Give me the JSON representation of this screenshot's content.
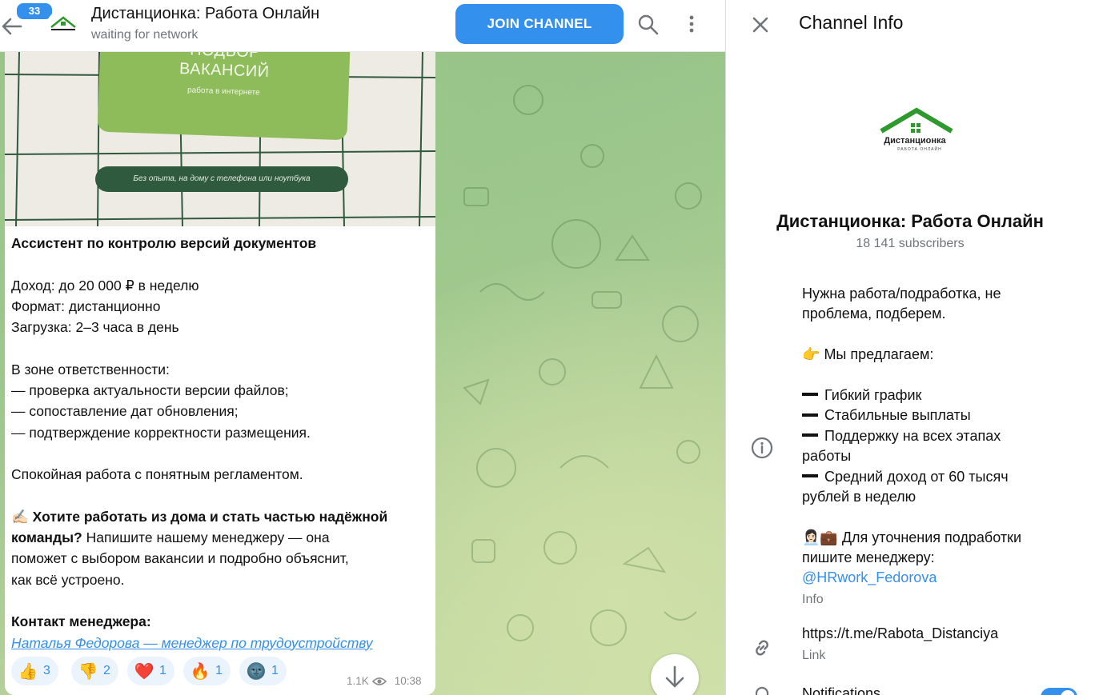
{
  "header": {
    "unread_count": "33",
    "title": "Дистанционка: Работа Онлайн",
    "status": "waiting for network",
    "join_label": "JOIN CHANNEL"
  },
  "message": {
    "image": {
      "title_top": "ПОДБОР",
      "title": "ВАКАНСИЙ",
      "subtitle": "работа в интернете",
      "pill": "Без опыта, на дому с телефона или ноутбука"
    },
    "lines": {
      "l1": "Ассистент по контролю версий документов",
      "l2": "Доход: до 20 000 ₽ в неделю",
      "l3": "Формат: дистанционно",
      "l4": "Загрузка: 2–3 часа в день",
      "l5": "В зоне ответственности:",
      "l6": "— проверка актуальности версии файлов;",
      "l7": "— сопоставление дат обновления;",
      "l8": "— подтверждение корректности размещения.",
      "l9": "Спокойная работа с понятным регламентом.",
      "l10_emoji": "✍🏻",
      "l10_bold": "Хотите работать из дома и стать частью надёжной",
      "l11_bold": "команды?",
      "l11_rest": "Напишите нашему менеджеру — она",
      "l12": "поможет с выбором вакансии и подробно объяснит,",
      "l13": "как всё устроено.",
      "l14": "Контакт менеджера:",
      "link": "Наталья Федорова — менеджер по трудоустройству"
    },
    "reactions": [
      {
        "emoji": "👍",
        "count": "3"
      },
      {
        "emoji": "👎",
        "count": "2"
      },
      {
        "emoji": "❤️",
        "count": "1"
      },
      {
        "emoji": "🔥",
        "count": "1"
      },
      {
        "emoji": "🌚",
        "count": "1"
      }
    ],
    "views": "1.1K",
    "time": "10:38"
  },
  "panel": {
    "title": "Channel Info",
    "channel_name": "Дистанционка: Работа Онлайн",
    "subscribers": "18 141 subscribers",
    "logo_text": "Дистанционка",
    "logo_sub": "РАБОТА ОНЛАЙН",
    "about": {
      "a1": "Нужна работа/подработка, не",
      "a2": "проблема, подберем.",
      "a3_emoji": "👉",
      "a3": "Мы предлагаем:",
      "a4": "Гибкий график",
      "a5": "Стабильные выплаты",
      "a6": "Поддержку на всех этапах",
      "a7": "работы",
      "a8": "Средний доход от 60 тысяч",
      "a9": "рублей в неделю",
      "a10_emoji": "👩🏻‍💼💼",
      "a10": "Для уточнения подработки",
      "a11": "пишите менеджеру:",
      "a12": "@HRwork_Fedorova"
    },
    "info_label": "Info",
    "link_url": "https://t.me/Rabota_Distanciya",
    "link_label": "Link",
    "notifications_label": "Notifications"
  },
  "colors": {
    "accent": "#3390ec",
    "logo_green": "#2e9a2e"
  },
  "icons": [
    "back-arrow-icon",
    "search-icon",
    "more-vertical-icon",
    "chevron-down-icon",
    "close-icon",
    "info-icon",
    "link-icon",
    "bell-icon",
    "eye-icon"
  ]
}
